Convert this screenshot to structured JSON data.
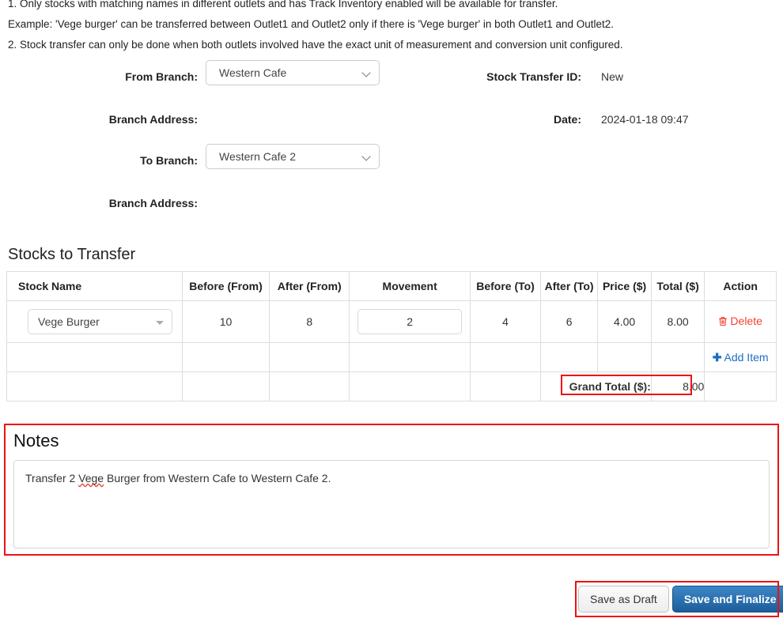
{
  "intro": {
    "lines": [
      "1. Only stocks with matching names in different outlets and has Track Inventory enabled will be available for transfer.",
      "Example: 'Vege burger' can be transferred between Outlet1 and Outlet2 only if there is 'Vege burger' in both Outlet1 and Outlet2.",
      "2. Stock transfer can only be done when both outlets involved have the exact unit of measurement and conversion unit configured."
    ]
  },
  "form": {
    "from_branch_label": "From Branch:",
    "from_branch_value": "Western Cafe",
    "from_branch_address_label": "Branch Address:",
    "from_branch_address_value": "",
    "to_branch_label": "To Branch:",
    "to_branch_value": "Western Cafe 2",
    "to_branch_address_label": "Branch Address:",
    "to_branch_address_value": "",
    "stock_transfer_id_label": "Stock Transfer ID:",
    "stock_transfer_id_value": "New",
    "date_label": "Date:",
    "date_value": "2024-01-18 09:47"
  },
  "stocks_section": {
    "title": "Stocks to Transfer",
    "columns": [
      "Stock Name",
      "Before (From)",
      "After (From)",
      "Movement",
      "Before (To)",
      "After (To)",
      "Price ($)",
      "Total ($)",
      "Action"
    ],
    "rows": [
      {
        "stock_name": "Vege Burger",
        "before_from": "10",
        "after_from": "8",
        "movement": "2",
        "before_to": "4",
        "after_to": "6",
        "price": "4.00",
        "total": "8.00",
        "action_label": "Delete"
      }
    ],
    "add_item_label": "Add Item",
    "grand_total_label": "Grand Total ($):",
    "grand_total_value": "8.00"
  },
  "notes": {
    "title": "Notes",
    "text_prefix": "Transfer 2 ",
    "text_misspelled": "Vege",
    "text_suffix": " Burger from Western Cafe to Western Cafe 2."
  },
  "actions": {
    "save_draft_label": "Save as Draft",
    "save_finalize_label": "Save and Finalize"
  },
  "colors": {
    "annotation_red": "#ee1111",
    "delete_red": "#f4402e",
    "link_blue": "#1b6ec2",
    "primary_button_blue": "#1c5d9b"
  }
}
